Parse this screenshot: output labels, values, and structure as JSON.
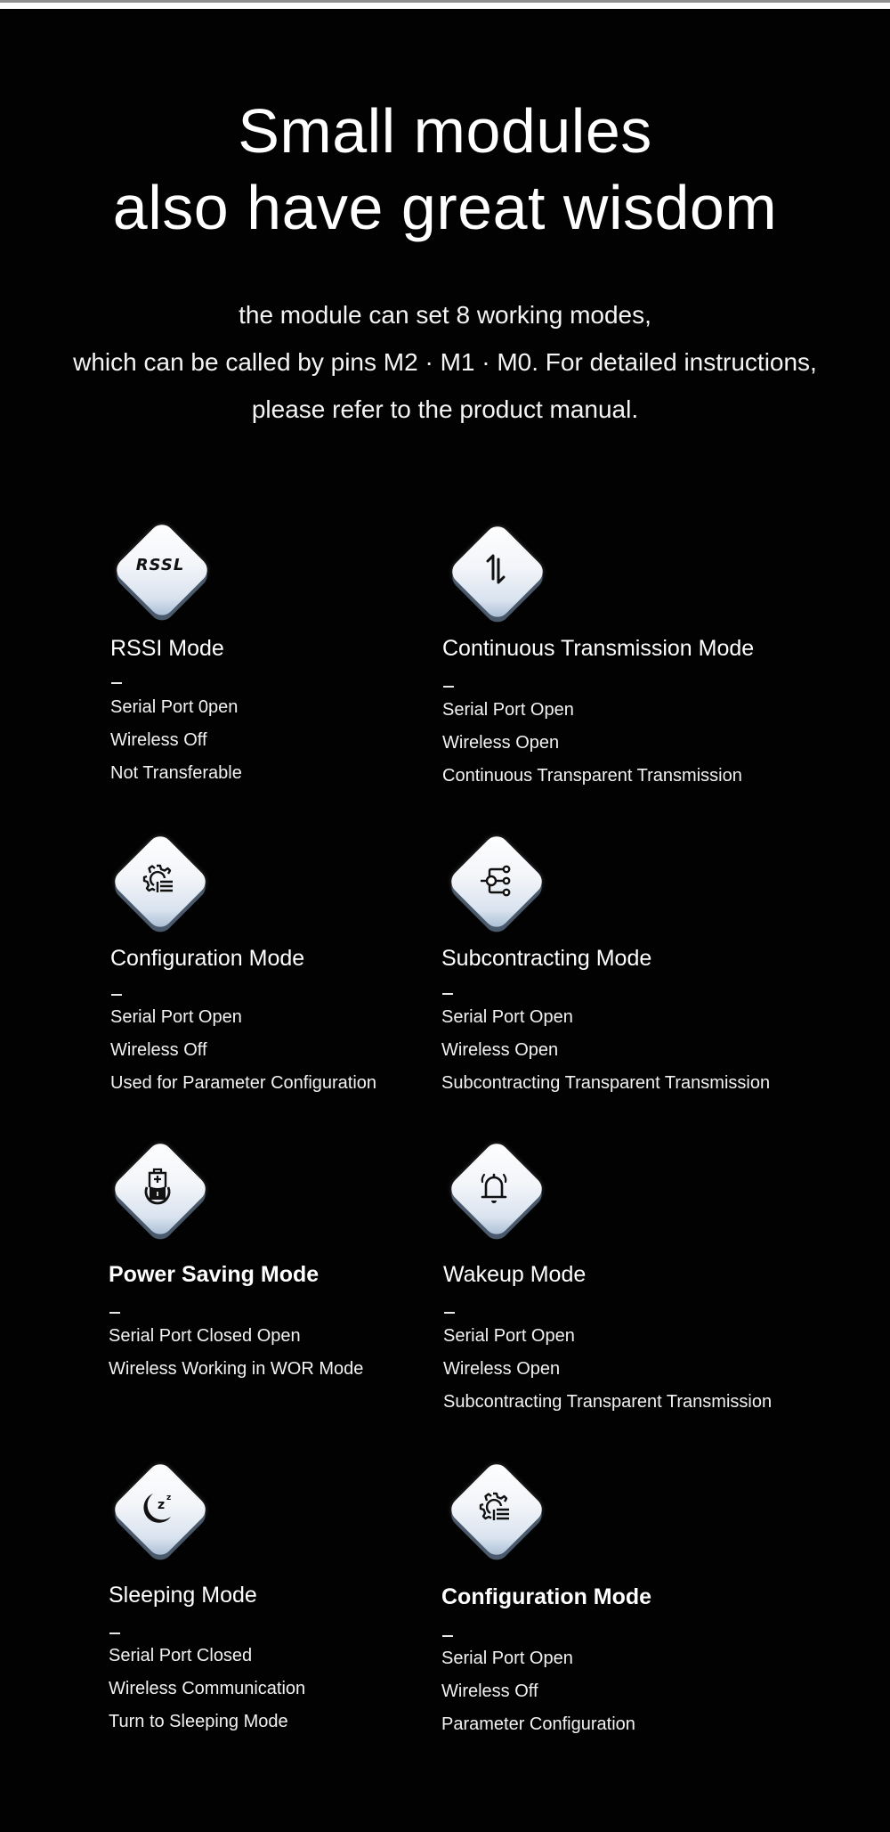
{
  "headline": {
    "line1": "Small modules",
    "line2": "also have great wisdom"
  },
  "intro": {
    "line1": "the module can set 8 working modes,",
    "line2": "which can be called by pins M2 · M1 · M0. For detailed instructions,",
    "line3": "please refer to the product manual."
  },
  "modes": [
    {
      "icon": "rssl-icon",
      "icon_text": "RSSL",
      "title": "RSSI Mode",
      "features": [
        "Serial Port 0pen",
        "Wireless Off",
        "Not Transferable"
      ]
    },
    {
      "icon": "up-down-arrows-icon",
      "title": "Continuous Transmission Mode",
      "features": [
        "Serial Port Open",
        "Wireless Open",
        "Continuous Transparent Transmission"
      ]
    },
    {
      "icon": "gear-list-icon",
      "title": "Configuration Mode",
      "features": [
        "Serial Port Open",
        "Wireless Off",
        "Used for Parameter Configuration"
      ]
    },
    {
      "icon": "branch-nodes-icon",
      "title": "Subcontracting Mode",
      "features": [
        "Serial Port Open",
        "Wireless Open",
        "Subcontracting Transparent Transmission"
      ]
    },
    {
      "icon": "battery-cycle-icon",
      "title": "Power Saving Mode",
      "features": [
        "Serial Port Closed Open",
        "Wireless Working in WOR Mode"
      ]
    },
    {
      "icon": "bell-ringing-icon",
      "title": "Wakeup Mode",
      "features": [
        "Serial Port Open",
        "Wireless Open",
        "Subcontracting Transparent Transmission"
      ]
    },
    {
      "icon": "moon-sleep-icon",
      "title": "Sleeping Mode",
      "features": [
        "Serial Port Closed",
        "Wireless Communication",
        "Turn to Sleeping Mode"
      ]
    },
    {
      "icon": "gear-list-icon",
      "title": "Configuration Mode",
      "features": [
        "Serial Port Open",
        "Wireless Off",
        "Parameter Configuration"
      ]
    }
  ],
  "colors": {
    "background": "#020202",
    "text": "#ffffff",
    "badge_top": "#ffffff",
    "badge_bottom": "#9fb6cf",
    "badge_shadow": "#4a5a6c"
  }
}
